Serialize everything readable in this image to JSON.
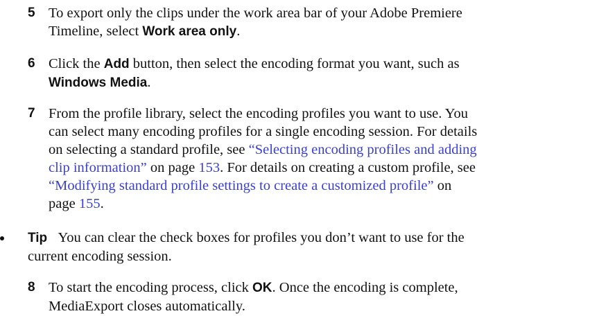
{
  "steps": [
    {
      "number": "5",
      "line1": "To export only the clips under the work area bar of your Adobe Premiere",
      "line2_pre": "Timeline, select ",
      "line2_bold": "Work area only",
      "line2_post": "."
    },
    {
      "number": "6",
      "line1_pre": "Click the ",
      "line1_bold": "Add",
      "line1_post": " button, then select the encoding format you want, such as",
      "line2_bold": "Windows Media",
      "line2_post": "."
    },
    {
      "number": "7",
      "line1": "From the profile library, select the encoding profiles you want to use. You",
      "line2": "can select many encoding profiles for a single encoding session. For details",
      "line3_pre": "on selecting a standard profile, see ",
      "link1_a": "“Selecting encoding profiles and adding",
      "link1_b": "clip information”",
      "link1_mid": " on page ",
      "page1": "153",
      "link1_post": ". For details on creating a custom profile, see",
      "link2": "“Modifying standard profile settings to create a customized profile”",
      "link2_mid": " on",
      "line6_pre": "page ",
      "page2": "155",
      "line6_post": "."
    },
    {
      "number": "8",
      "line1_pre": "To start the encoding process, click ",
      "line1_bold": "OK",
      "line1_post": ". Once the encoding is complete,",
      "line2": "MediaExport closes automatically."
    }
  ],
  "tip": {
    "label": "Tip",
    "line1": "You can clear the check boxes for profiles you don’t want to use for the",
    "line2": "current encoding session."
  }
}
